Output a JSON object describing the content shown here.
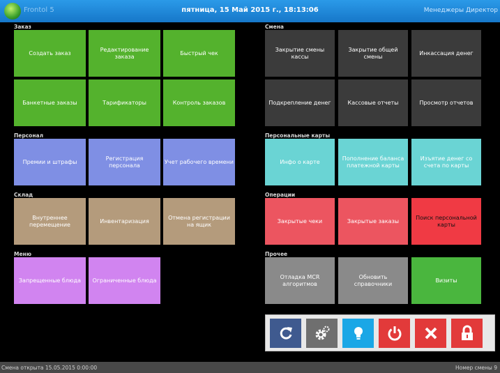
{
  "header": {
    "app_name": "Frontol 5",
    "datetime": "пятница, 15 Май 2015 г., 18:13:06",
    "user": "Менеджеры Директор"
  },
  "sections": {
    "order": "Заказ",
    "shift": "Смена",
    "staff": "Персонал",
    "personal_cards": "Персональные карты",
    "warehouse": "Склад",
    "operations": "Операции",
    "menu": "Меню",
    "other": "Прочее"
  },
  "tiles": {
    "create_order": "Создать заказ",
    "edit_order": "Редактирование заказа",
    "quick_receipt": "Быстрый чек",
    "banquet_orders": "Банкетные заказы",
    "tariffs": "Тарификаторы",
    "order_control": "Контроль заказов",
    "close_cash_shift": "Закрытие смены кассы",
    "close_common_shift": "Закрытие общей смены",
    "cash_collection": "Инкассация денег",
    "cash_reinforcement": "Подкрепление денег",
    "cash_reports": "Кассовые отчеты",
    "view_reports": "Просмотр отчетов",
    "bonuses_fines": "Премии и штрафы",
    "staff_registration": "Регистрация персонала",
    "work_time": "Учет рабочего времени",
    "card_info": "Инфо о карте",
    "card_topup": "Пополнение баланса платежной карты",
    "card_withdraw": "Изъятие денег со счета по карты",
    "internal_transfer": "Внутреннее перемещение",
    "inventory": "Инвентаризация",
    "cancel_box_registration": "Отмена регистрации на ящик",
    "closed_receipts": "Закрытые чеки",
    "closed_orders": "Закрытые заказы",
    "find_personal_card": "Поиск персональной карты",
    "forbidden_dishes": "Запрещенные блюда",
    "limited_dishes": "Ограниченные блюда",
    "debug_mcr": "Отладка MCR алгоритмов",
    "refresh_dictionaries": "Обновить справочники",
    "visits": "Визиты"
  },
  "toolbar_icons": [
    "refresh-icon",
    "gears-icon",
    "lightbulb-icon",
    "power-icon",
    "close-icon",
    "lock-icon"
  ],
  "colors": {
    "header": "#1677c9",
    "green": "#54b22d",
    "dark": "#3b3b3b",
    "blue": "#7f8fe4",
    "tan": "#b49b7c",
    "violet": "#d184f0",
    "teal": "#6ad4d4",
    "red": "#ec5560",
    "bright_red": "#f03a44",
    "gray": "#8a8a8a"
  },
  "status": {
    "left": "Смена открыта 15.05.2015 0:00:00",
    "right": "Номер смены 9"
  }
}
